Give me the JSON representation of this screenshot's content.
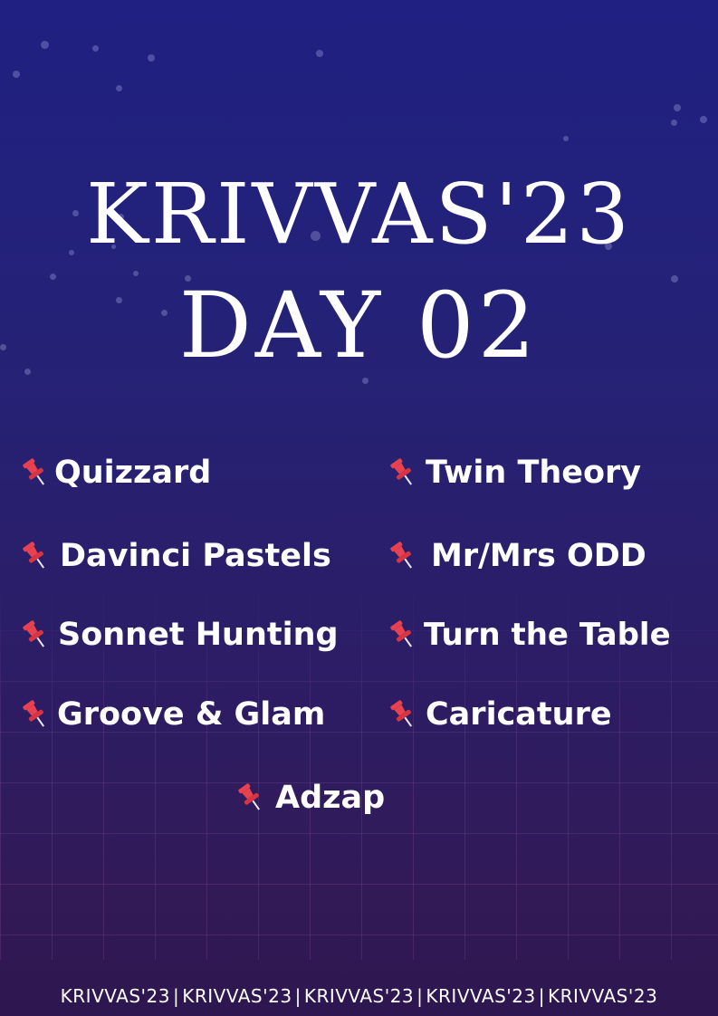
{
  "poster": {
    "title": "KRIVVAS'23",
    "day_label": "DAY",
    "day_number": "02",
    "pin_icon": "pushpin-icon",
    "pin_color": "#e8414f",
    "events_left": [
      "Quizzard",
      "Davinci Pastels",
      "Sonnet Hunting",
      "Groove & Glam"
    ],
    "events_right": [
      "Twin Theory",
      "Mr/Mrs ODD",
      "Turn the Table",
      "Caricature"
    ],
    "events_center": [
      "Adzap"
    ],
    "footer": [
      "KRIVVAS'23",
      "KRIVVAS'23",
      "KRIVVAS'23",
      "KRIVVAS'23",
      "KRIVVAS'23"
    ],
    "footer_separator": "|"
  }
}
